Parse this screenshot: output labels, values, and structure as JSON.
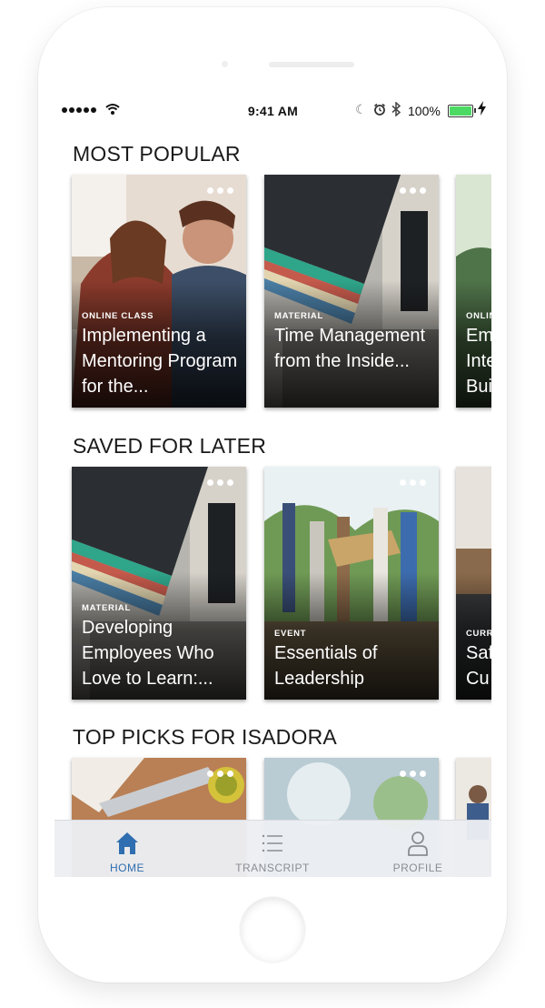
{
  "status_bar": {
    "time": "9:41 AM",
    "battery": "100%",
    "icons": [
      "signal-dots-icon",
      "wifi-icon",
      "moon-icon",
      "alarm-icon",
      "bluetooth-icon",
      "battery-icon",
      "charging-bolt-icon"
    ]
  },
  "sections": [
    {
      "title": "MOST POPULAR",
      "cards": [
        {
          "type": "ONLINE CLASS",
          "title": "Implementing a Mentoring Program for the..."
        },
        {
          "type": "MATERIAL",
          "title": "Time Management from the Inside..."
        },
        {
          "type": "ONLINE",
          "title": "Em Inte Bui"
        }
      ]
    },
    {
      "title": "SAVED FOR LATER",
      "cards": [
        {
          "type": "MATERIAL",
          "title": "Developing Employees Who Love to Learn:..."
        },
        {
          "type": "EVENT",
          "title": "Essentials of Leadership"
        },
        {
          "type": "CURR",
          "title": "Saf Cu"
        }
      ]
    },
    {
      "title": "TOP PICKS FOR ISADORA",
      "cards": []
    }
  ],
  "tabbar": {
    "tabs": [
      {
        "label": "HOME",
        "icon": "home-icon",
        "active": true
      },
      {
        "label": "TRANSCRIPT",
        "icon": "list-icon",
        "active": false
      },
      {
        "label": "PROFILE",
        "icon": "person-icon",
        "active": false
      }
    ]
  },
  "colors": {
    "accent": "#2f6eb0",
    "tab_inactive": "#8a8d93",
    "title_text": "#1a1a1a"
  }
}
